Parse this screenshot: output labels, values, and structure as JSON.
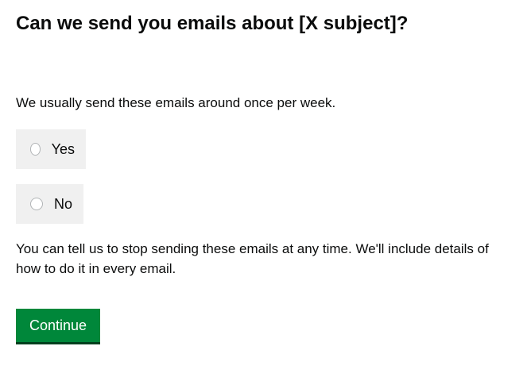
{
  "title": "Can we send you emails about [X subject]?",
  "hint": "We usually send these emails around once per week.",
  "options": [
    {
      "label": "Yes"
    },
    {
      "label": "No"
    }
  ],
  "info": "You can tell us to stop sending these emails at any time. We'll include details of how to do it in every email.",
  "continue_label": "Continue"
}
